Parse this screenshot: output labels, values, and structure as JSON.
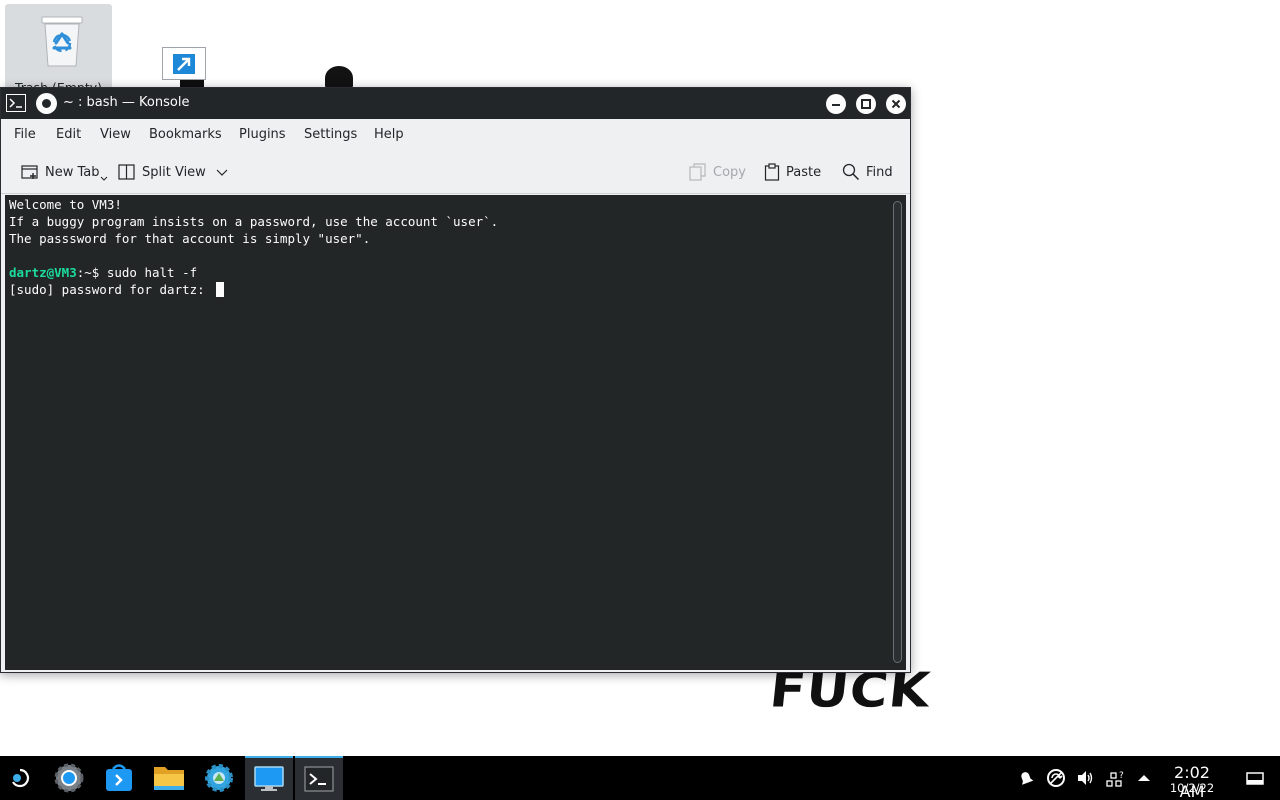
{
  "desktop": {
    "trash_label": "Trash (Empty)",
    "graffiti_text": "FUCK"
  },
  "window": {
    "title": "~ : bash — Konsole",
    "menu": [
      "File",
      "Edit",
      "View",
      "Bookmarks",
      "Plugins",
      "Settings",
      "Help"
    ],
    "toolbar": {
      "new_tab": "New Tab",
      "split_view": "Split View",
      "copy": "Copy",
      "paste": "Paste",
      "find": "Find"
    }
  },
  "terminal": {
    "lines": [
      "Welcome to VM3!",
      "If a buggy program insists on a password, use the account `user`.",
      "The passsword for that account is simply \"user\"."
    ],
    "prompt_user": "dartz@VM3",
    "prompt_path": ":~$ ",
    "command": "sudo halt -f",
    "sudo_prompt": "[sudo] password for dartz: "
  },
  "taskbar": {
    "apps": [
      "app-launcher",
      "system-settings",
      "discover",
      "dolphin-file-manager",
      "system-settings-gear",
      "desktop",
      "konsole"
    ],
    "active_app": "konsole",
    "time": "2:02 AM",
    "date": "10/2/22"
  },
  "colors": {
    "accent": "#3daee9",
    "prompt_green": "#1cdc9a",
    "terminal_bg": "#232627",
    "titlebar_bg": "#232629"
  }
}
